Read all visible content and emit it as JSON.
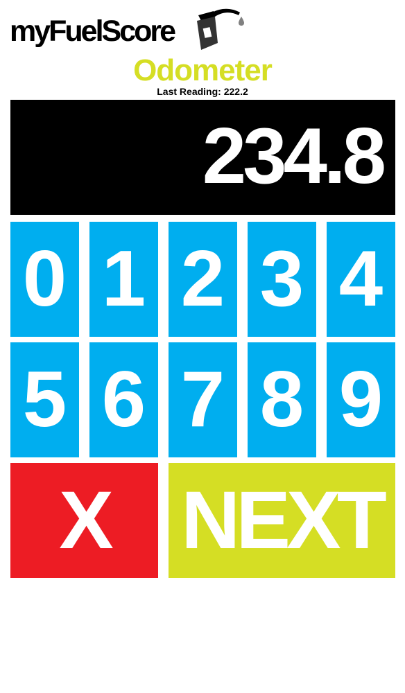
{
  "header": {
    "brand": "myFuelScore",
    "brand_icon": "fuel-pump-icon",
    "title": "Odometer",
    "last_reading": "Last Reading: 222.2"
  },
  "display": {
    "value": "234.8"
  },
  "keypad": {
    "keys": [
      "0",
      "1",
      "2",
      "3",
      "4",
      "5",
      "6",
      "7",
      "8",
      "9"
    ],
    "clear_label": "X",
    "next_label": "NEXT"
  },
  "colors": {
    "title": "#d5de24",
    "digit_key": "#00aeef",
    "clear_key": "#ed1c24",
    "next_key": "#d5de24",
    "display_bg": "#000000",
    "key_text": "#ffffff"
  }
}
